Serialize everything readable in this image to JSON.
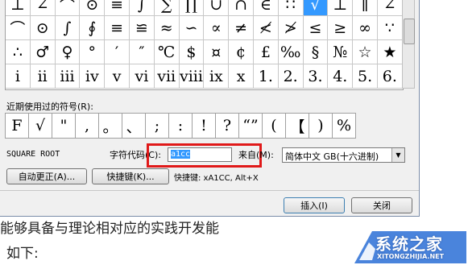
{
  "symbol_grid": {
    "rows": [
      [
        "⊥",
        "∠",
        "⌒",
        "⊙",
        "≡",
        "∫",
        "∑",
        "∏",
        "∪",
        "∩",
        "∈",
        "∷",
        "√",
        "⊥",
        "∥",
        "∠"
      ],
      [
        "⌒",
        "⊙",
        "∫",
        "∮",
        "≡",
        "≌",
        "≈",
        "∽",
        "∝",
        "≠",
        "≮",
        "≯",
        "≤",
        "≥",
        "∞",
        "∵"
      ],
      [
        "∴",
        "♂",
        "♀",
        "°",
        "′",
        "″",
        "℃",
        "$",
        "¤",
        "¢",
        "£",
        "‰",
        "§",
        "№",
        "☆",
        "★"
      ],
      [
        "i",
        "ii",
        "iii",
        "iv",
        "v",
        "vi",
        "vii",
        "viii",
        "ix",
        "x",
        "1.",
        "2.",
        "3.",
        "4.",
        "5.",
        "6."
      ]
    ],
    "selected_row": 0,
    "selected_col": 12
  },
  "recent": {
    "label": "近期使用过的符号(R):",
    "items": [
      "F",
      "√",
      "\"",
      ",",
      "。",
      "、",
      ";",
      ":",
      "!",
      "?",
      "“”",
      "(",
      "【",
      ")",
      "%"
    ]
  },
  "char_name": "SQUARE ROOT",
  "code": {
    "label": "字符代码(C):",
    "value": "a1cc",
    "from_label": "来自(M):",
    "from_value": "简体中文 GB(十六进制)"
  },
  "buttons": {
    "autocorrect": "自动更正(A)...",
    "shortcut_key": "快捷键(K)...",
    "insert": "插入(I)",
    "close": "关闭"
  },
  "shortcut_text": "快捷键: xA1CC, Alt+X",
  "doc": {
    "line1": "能够具备与理论相对应的实践开发能",
    "line2": "如下:"
  },
  "watermark": {
    "name": "系统之家",
    "url": "XITONGZHIJIA.NET"
  },
  "colors": {
    "selection": "#3399ff",
    "highlight_box": "#e01919",
    "logo_blue": "#2a6fd6"
  }
}
